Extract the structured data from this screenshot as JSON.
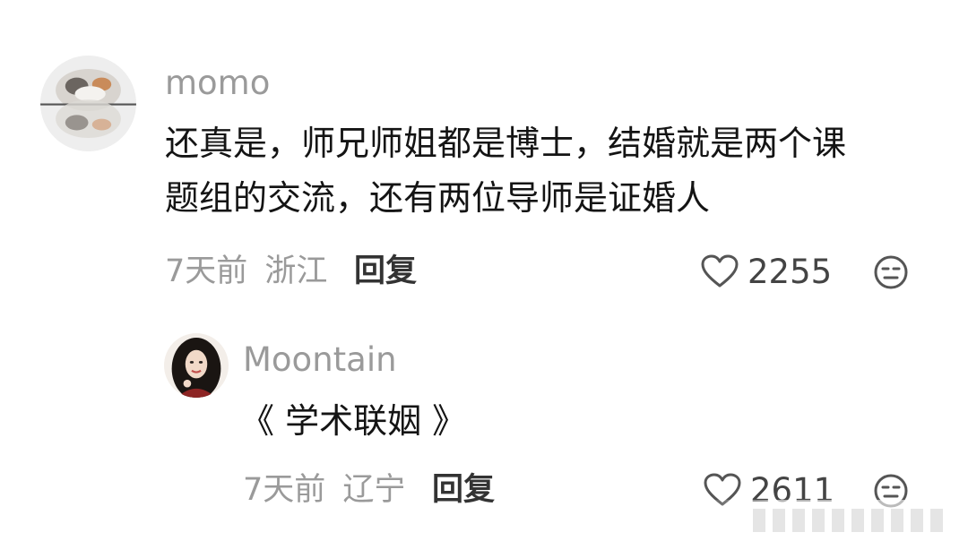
{
  "comments": [
    {
      "username": "momo",
      "text_line1": "还真是，师兄师姐都是博士，结婚就是两个课",
      "text_line2": "题组的交流，还有两位导师是证婚人",
      "time": "7天前",
      "location": "浙江",
      "reply_label": "回复",
      "like_count": "2255",
      "avatar_icon": "cat-avatar-icon"
    },
    {
      "username": "Moontain",
      "text_line1": "《 学术联姻 》",
      "time": "7天前",
      "location": "辽宁",
      "reply_label": "回复",
      "like_count": "2611",
      "avatar_icon": "woman-avatar-icon"
    }
  ],
  "colors": {
    "username": "#9a9a9a",
    "text": "#141414",
    "meta": "#9a9a9a",
    "icon": "#555555"
  }
}
